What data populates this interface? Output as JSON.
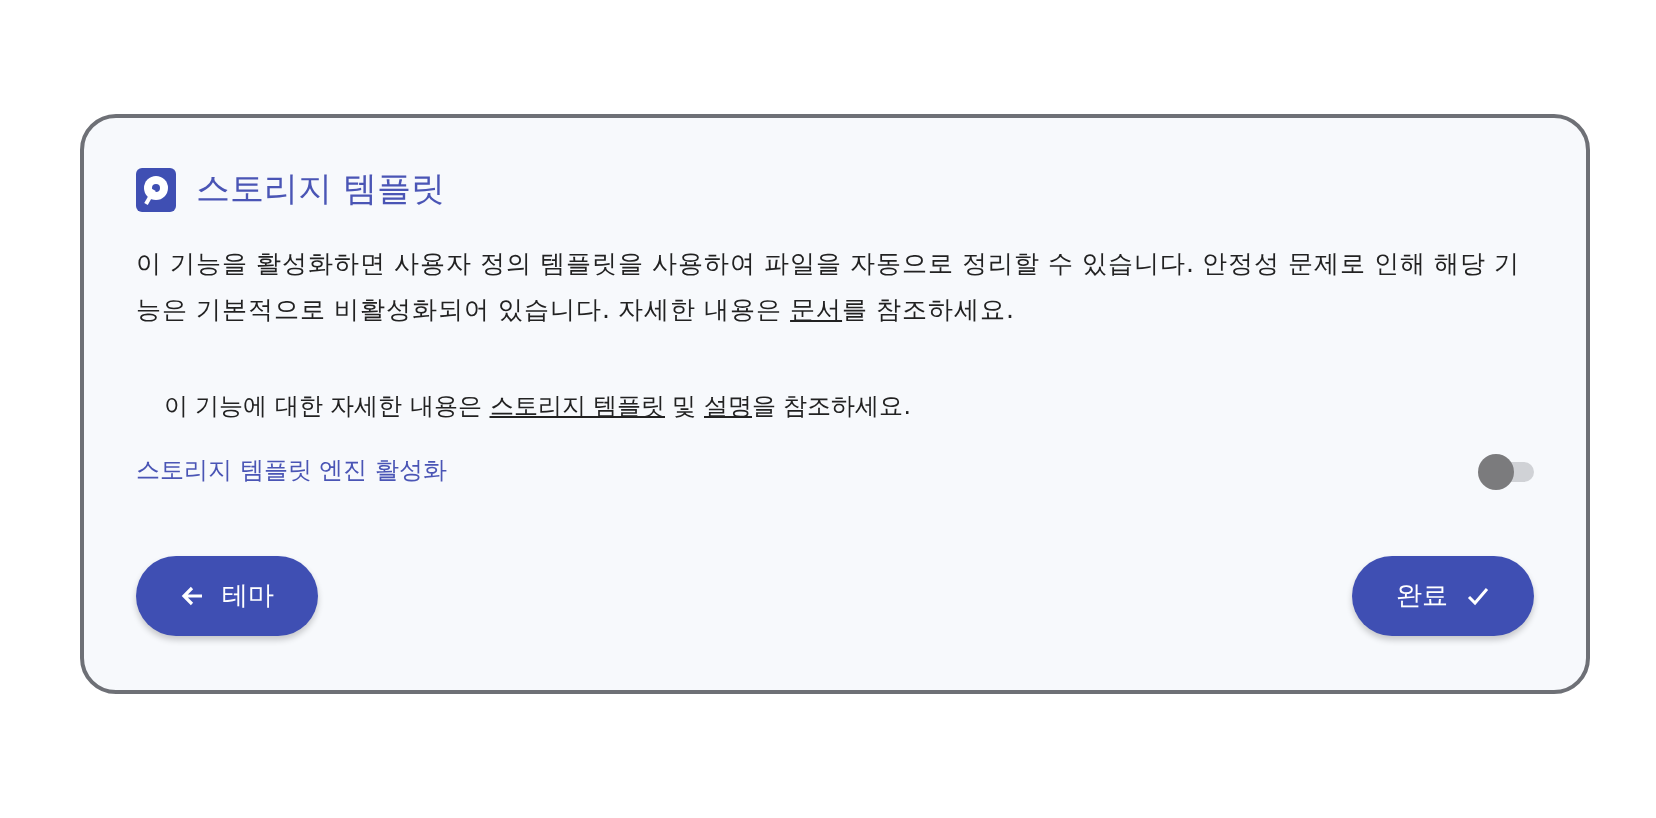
{
  "title": "스토리지 템플릿",
  "description": {
    "before": "이 기능을 활성화하면 사용자 정의 템플릿을 사용하여 파일을 자동으로 정리할 수 있습니다. 안정성 문제로 인해 해당 기능은 기본적으로 비활성화되어 있습니다. 자세한 내용은 ",
    "link": "문서",
    "after": "를 참조하세요."
  },
  "note": {
    "before": "이 기능에 대한 자세한 내용은 ",
    "link1": "스토리지 템플릿",
    "middle": " 및 ",
    "link2": "설명",
    "after": "을 참조하세요."
  },
  "toggle": {
    "label": "스토리지 템플릿 엔진 활성화",
    "on": false
  },
  "buttons": [
    {
      "label": "테마",
      "kind": "back"
    },
    {
      "label": "완료",
      "kind": "done"
    }
  ]
}
